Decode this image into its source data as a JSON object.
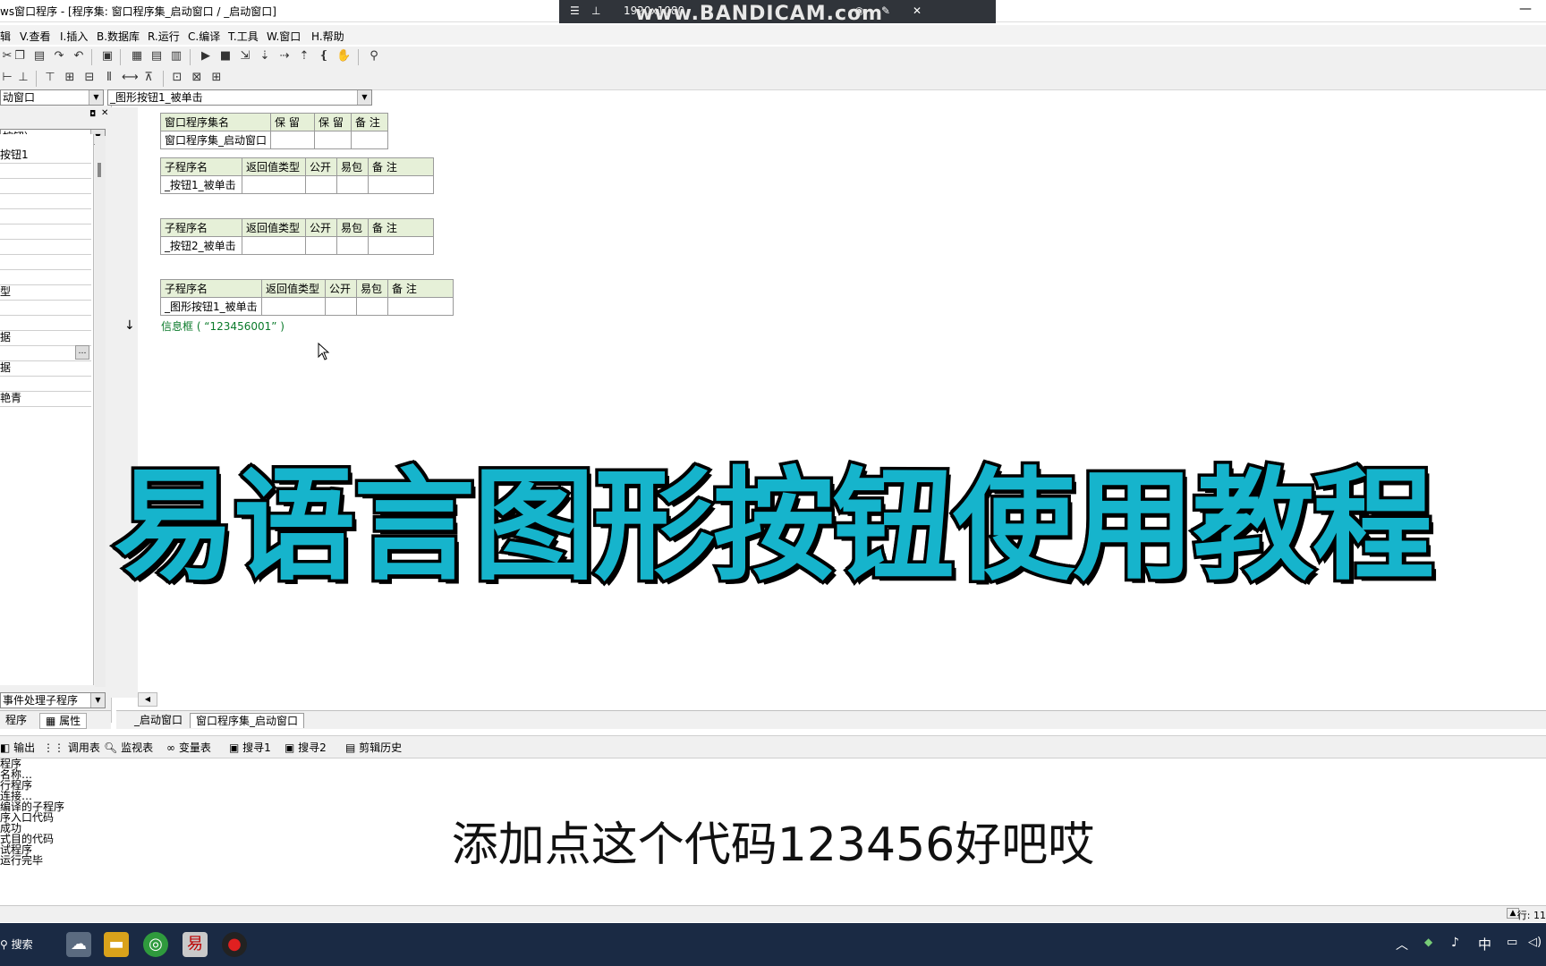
{
  "window": {
    "title": "ws窗口程序 - [程序集: 窗口程序集_启动窗口 / _启动窗口]",
    "minimize_glyph": "—"
  },
  "recorder": {
    "resolution": "1920x1080",
    "watermark": "www.BANDICAM.com"
  },
  "menu": {
    "items": [
      "辑",
      "V.查看",
      "I.插入",
      "B.数据库",
      "R.运行",
      "C.编译",
      "T.工具",
      "W.窗口",
      "H.帮助"
    ]
  },
  "selectors": {
    "object_combo": "动窗口",
    "method_combo": "_图形按钮1_被单击"
  },
  "left_panel": {
    "component_combo": "按钮）",
    "properties": [
      {
        "label": "按钮1"
      },
      {
        "label": ""
      },
      {
        "label": ""
      },
      {
        "label": ""
      },
      {
        "label": ""
      },
      {
        "label": ""
      },
      {
        "label": ""
      },
      {
        "label": ""
      },
      {
        "label": ""
      },
      {
        "label": "型"
      },
      {
        "label": ""
      },
      {
        "label": ""
      },
      {
        "label": "据"
      },
      {
        "label": ""
      },
      {
        "label": "据"
      },
      {
        "label": ""
      },
      {
        "label": "艳青"
      }
    ],
    "event_combo": "事件处理子程序",
    "tabs": [
      "程序",
      "属性"
    ]
  },
  "editor": {
    "assembly_table": {
      "headers": [
        "窗口程序集名",
        "保 留",
        "保 留",
        "备 注"
      ],
      "row": [
        "窗口程序集_启动窗口",
        "",
        "",
        ""
      ]
    },
    "sub_tables": [
      {
        "headers": [
          "子程序名",
          "返回值类型",
          "公开",
          "易包",
          "备 注"
        ],
        "row": [
          "_按钮1_被单击",
          "",
          "",
          "",
          ""
        ]
      },
      {
        "headers": [
          "子程序名",
          "返回值类型",
          "公开",
          "易包",
          "备 注"
        ],
        "row": [
          "_按钮2_被单击",
          "",
          "",
          "",
          ""
        ]
      },
      {
        "headers": [
          "子程序名",
          "返回值类型",
          "公开",
          "易包",
          "备 注"
        ],
        "row": [
          "_图形按钮1_被单击",
          "",
          "",
          "",
          ""
        ]
      }
    ],
    "code_line": "信息框 ( “123456001” )",
    "arrow_glyph": "↓"
  },
  "overlay": {
    "title": "易语言图形按钮使用教程",
    "subtitle": "添加点这个代码123456好吧哎"
  },
  "doc_tabs": [
    "_启动窗口",
    "窗口程序集_启动窗口"
  ],
  "output_tabs": [
    "输出",
    "调用表",
    "监视表",
    "变量表",
    "搜寻1",
    "搜寻2",
    "剪辑历史"
  ],
  "output_lines": [
    "程序",
    "名称…",
    "行程序",
    "连接…",
    "编译的子程序",
    "序入口代码",
    "成功",
    "式目的代码",
    "试程序",
    "运行完毕"
  ],
  "status": {
    "line_label": "行: 11"
  },
  "taskbar": {
    "search_label": "搜索",
    "tray_ime": "中"
  },
  "colors": {
    "title_fill": "#16b4cc",
    "table_header_bg": "#e6f0d8",
    "code_green": "#0a7a2a",
    "taskbar_bg": "#1a2a44"
  }
}
